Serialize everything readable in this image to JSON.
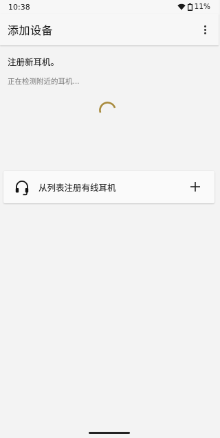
{
  "status_bar": {
    "time": "10:38",
    "battery": "11%",
    "icons": [
      "wifi-icon",
      "battery-icon"
    ]
  },
  "app_bar": {
    "title": "添加设备",
    "overflow_icon": "more-vert-icon"
  },
  "main": {
    "register_title": "注册新耳机。",
    "detecting_text": "正在检测附近的耳机...",
    "wired_card": {
      "label": "从列表注册有线耳机",
      "icon": "headset-icon",
      "action_icon": "plus-icon"
    }
  },
  "colors": {
    "background": "#f3f3f3",
    "app_bar": "#f7f7f7",
    "spinner": "#a88a3c",
    "card": "#fafafa"
  }
}
